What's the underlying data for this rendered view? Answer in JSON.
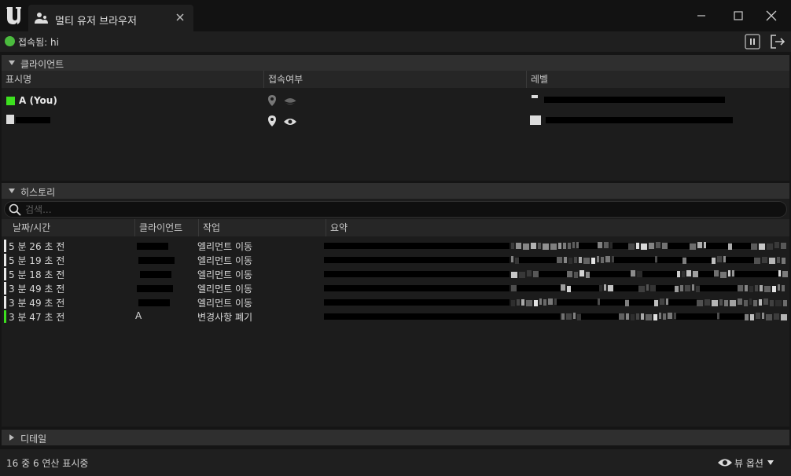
{
  "window": {
    "tab_title": "멀티 유저 브라우저",
    "icons": [
      "unreal-logo-icon",
      "multi-user-icon",
      "close-icon",
      "minimize-icon",
      "maximize-icon",
      "window-close-icon"
    ]
  },
  "status": {
    "text": "접속됨: hi",
    "color": "#4bbb3e",
    "icons": [
      "pause-icon",
      "leave-session-icon"
    ]
  },
  "clients": {
    "section_label": "클라이언트",
    "columns": [
      "표시명",
      "접속여부",
      "레벨"
    ],
    "rows": [
      {
        "name": "A (You)",
        "color": "#3de01f",
        "icons": [
          "location-pin-icon",
          "eye-closed-icon"
        ]
      },
      {
        "name": "",
        "icons": [
          "location-pin-icon",
          "eye-icon"
        ]
      }
    ]
  },
  "history": {
    "section_label": "히스토리",
    "search_placeholder": "검색...",
    "columns": [
      "날짜/시간",
      "클라이언트",
      "작업",
      "요약"
    ],
    "rows": [
      {
        "time": "5 분 26 초 전",
        "client": "",
        "action": "엘리먼트 이동",
        "marker": "#e8e8e8"
      },
      {
        "time": "5 분 19 초 전",
        "client": "",
        "action": "엘리먼트 이동",
        "marker": "#e8e8e8"
      },
      {
        "time": "5 분 18 초 전",
        "client": "",
        "action": "엘리먼트 이동",
        "marker": "#e8e8e8"
      },
      {
        "time": "3 분 49 초 전",
        "client": "",
        "action": "엘리먼트 이동",
        "marker": "#e8e8e8"
      },
      {
        "time": "3 분 49 초 전",
        "client": "",
        "action": "엘리먼트 이동",
        "marker": "#e8e8e8"
      },
      {
        "time": "3 분 47 초 전",
        "client": "A",
        "action": "변경사항 폐기",
        "marker": "#3de01f"
      }
    ]
  },
  "details": {
    "section_label": "디테일"
  },
  "footer": {
    "count_text": "16 중 6 연산 표시중",
    "view_options_label": "뷰 옵션"
  }
}
